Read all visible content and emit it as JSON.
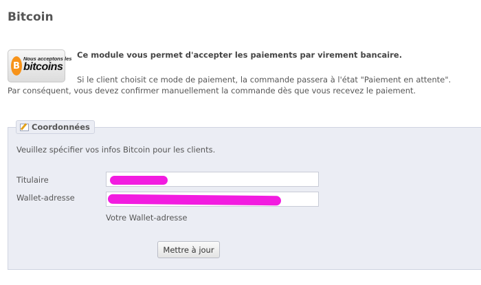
{
  "page": {
    "title": "Bitcoin"
  },
  "logo": {
    "small_text": "Nous acceptons les",
    "big_text": "bitcoins",
    "coin_symbol": "B"
  },
  "intro": {
    "bold_line": "Ce module vous permet d'accepter les paiements par virement bancaire.",
    "line1": "Si le client choisit ce mode de paiement, la commande passera à l'état \"Paiement en attente\".",
    "line2": "Par conséquent, vous devez confirmer manuellement la commande dès que vous recevez le paiement."
  },
  "form": {
    "legend": "Coordonnées",
    "legend_icon": "edit-icon",
    "instruction": "Veuillez spécifier vos infos Bitcoin pour les clients.",
    "titulaire_label": "Titulaire",
    "titulaire_value": "",
    "wallet_label": "Wallet-adresse",
    "wallet_value": "",
    "wallet_hint": "Votre Wallet-adresse",
    "submit_label": "Mettre à jour"
  },
  "colors": {
    "redaction": "#f21ce0",
    "panel_bg": "#ebedf4",
    "bitcoin_orange": "#f7931a"
  }
}
